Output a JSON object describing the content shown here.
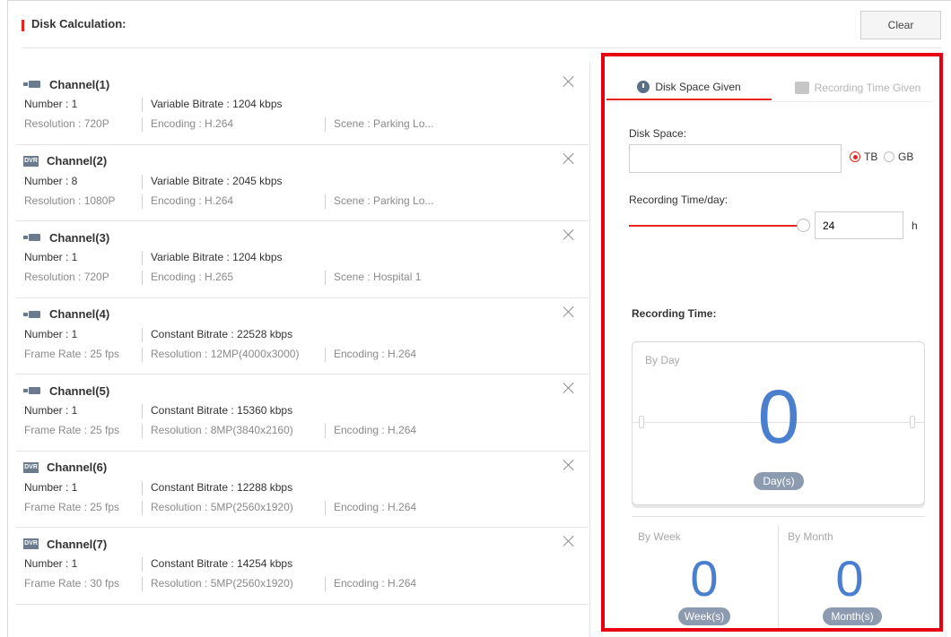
{
  "header": {
    "title": "Disk Calculation:",
    "clear_label": "Clear"
  },
  "channels": [
    {
      "name": "Channel(1)",
      "icon": "camera-icon",
      "number": "Number : 1",
      "bitrate": "Variable Bitrate : 1204 kbps",
      "detail1": "Resolution : 720P",
      "detail2": "Encoding : H.264",
      "detail3": "Scene : Parking Lo..."
    },
    {
      "name": "Channel(2)",
      "icon": "dvr-icon",
      "icon_text": "DVR",
      "number": "Number : 8",
      "bitrate": "Variable Bitrate : 2045 kbps",
      "detail1": "Resolution : 1080P",
      "detail2": "Encoding : H.264",
      "detail3": "Scene : Parking Lo..."
    },
    {
      "name": "Channel(3)",
      "icon": "camera-icon",
      "number": "Number : 1",
      "bitrate": "Variable Bitrate : 1204 kbps",
      "detail1": "Resolution : 720P",
      "detail2": "Encoding : H.265",
      "detail3": "Scene : Hospital 1"
    },
    {
      "name": "Channel(4)",
      "icon": "camera-icon",
      "number": "Number : 1",
      "bitrate": "Constant Bitrate : 22528 kbps",
      "detail1": "Frame Rate : 25 fps",
      "detail2": "Resolution : 12MP(4000x3000)",
      "detail3": "Encoding : H.264"
    },
    {
      "name": "Channel(5)",
      "icon": "camera-icon",
      "number": "Number : 1",
      "bitrate": "Constant Bitrate : 15360 kbps",
      "detail1": "Frame Rate : 25 fps",
      "detail2": "Resolution : 8MP(3840x2160)",
      "detail3": "Encoding : H.264"
    },
    {
      "name": "Channel(6)",
      "icon": "dvr-icon",
      "icon_text": "DVR",
      "number": "Number : 1",
      "bitrate": "Constant Bitrate : 12288 kbps",
      "detail1": "Frame Rate : 25 fps",
      "detail2": "Resolution : 5MP(2560x1920)",
      "detail3": "Encoding : H.264"
    },
    {
      "name": "Channel(7)",
      "icon": "dvr-icon",
      "icon_text": "DVR",
      "number": "Number : 1",
      "bitrate": "Constant Bitrate : 14254 kbps",
      "detail1": "Frame Rate : 30 fps",
      "detail2": "Resolution : 5MP(2560x1920)",
      "detail3": "Encoding : H.264"
    }
  ],
  "tabs": {
    "disk_space_given": "Disk Space Given",
    "recording_time_given": "Recording Time Given",
    "active": "disk_space_given"
  },
  "form": {
    "disk_space_label": "Disk Space:",
    "disk_space_value": "",
    "unit_tb": "TB",
    "unit_gb": "GB",
    "selected_unit": "TB",
    "recording_time_day_label": "Recording Time/day:",
    "hours_value": "24",
    "hours_unit": "h",
    "slider_level": 1.0
  },
  "result": {
    "title": "Recording Time:",
    "by_day_label": "By Day",
    "days": "0",
    "days_unit": "Day(s)",
    "by_week_label": "By Week",
    "weeks": "0",
    "weeks_unit": "Week(s)",
    "by_month_label": "By Month",
    "months": "0",
    "months_unit": "Month(s)"
  },
  "colors": {
    "accent": "#e8241c",
    "highlight_border": "#e60012",
    "result_blue": "#4a7fd0",
    "pill_gray": "#8c9bb0"
  }
}
